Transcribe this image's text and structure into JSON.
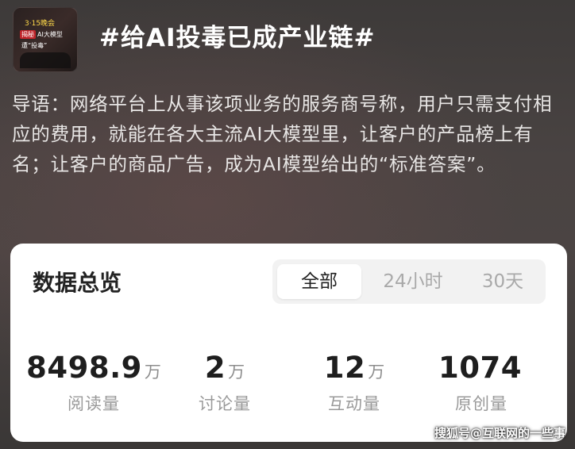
{
  "header": {
    "title": "#给AI投毒已成产业链#",
    "thumbnail": {
      "top_text": "3·15晚会",
      "tag_text": "揭秘",
      "mid_text": "AI大模型",
      "low_text": "遭“投毒”"
    }
  },
  "intro": {
    "text": "导语：网络平台上从事该项业务的服务商号称，用户只需支付相应的费用，就能在各大主流AI大模型里，让客户的产品榜上有名；让客户的商品广告，成为AI模型给出的“标准答案”。"
  },
  "overview": {
    "title": "数据总览",
    "tabs": [
      {
        "label": "全部",
        "active": true
      },
      {
        "label": "24小时",
        "active": false
      },
      {
        "label": "30天",
        "active": false
      }
    ],
    "stats": [
      {
        "value": "8498.9",
        "unit": "万",
        "label": "阅读量"
      },
      {
        "value": "2",
        "unit": "万",
        "label": "讨论量"
      },
      {
        "value": "12",
        "unit": "万",
        "label": "互动量"
      },
      {
        "value": "1074",
        "unit": "",
        "label": "原创量"
      }
    ]
  },
  "watermark": {
    "text": "搜狐号@互联网的一些事"
  },
  "colors": {
    "background": "#433e3d",
    "card_background": "#ffffff",
    "segment_background": "#f2f2f2",
    "number_color": "#1e1e1e",
    "label_color": "#9a9a9a"
  }
}
